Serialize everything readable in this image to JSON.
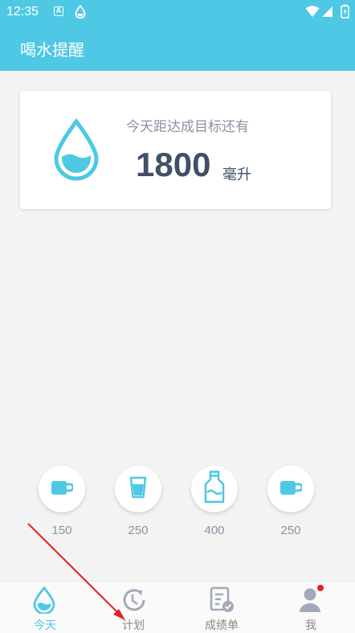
{
  "status_bar": {
    "time": "12:35",
    "icons": [
      "a-notification-icon",
      "drop-notification-icon",
      "wifi-icon",
      "signal-icon",
      "battery-icon"
    ]
  },
  "app_bar": {
    "title": "喝水提醒"
  },
  "goal_card": {
    "caption": "今天距达成目标还有",
    "amount": "1800",
    "unit": "毫升",
    "icon": "water-drop-icon"
  },
  "cups": [
    {
      "icon": "cup-icon",
      "amount": "150"
    },
    {
      "icon": "glass-icon",
      "amount": "250"
    },
    {
      "icon": "bottle-icon",
      "amount": "400"
    },
    {
      "icon": "cup-icon",
      "amount": "250"
    }
  ],
  "bottom_nav": {
    "items": [
      {
        "label": "今天",
        "icon": "water-drop-icon",
        "active": true
      },
      {
        "label": "计划",
        "icon": "history-icon",
        "active": false
      },
      {
        "label": "成绩单",
        "icon": "report-icon",
        "active": false
      },
      {
        "label": "我",
        "icon": "user-icon",
        "active": false,
        "badge": true
      }
    ]
  },
  "colors": {
    "primary": "#4ec8e4",
    "text_dark": "#3f5068",
    "text_muted": "#8a93a0",
    "nav_inactive": "#a3a9b8",
    "badge": "#e92128",
    "annotation": "#e8201f"
  }
}
